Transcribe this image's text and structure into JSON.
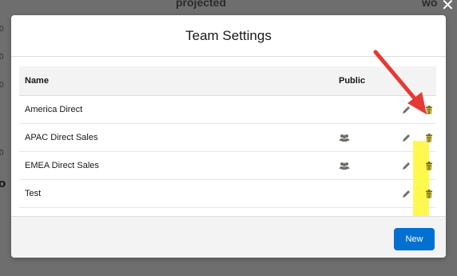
{
  "background": {
    "header_text_1": "projected",
    "header_text_2": "wo",
    "close_glyph": "✕",
    "left_numbers": [
      "0",
      "0",
      "0",
      "0"
    ],
    "left_big": "o"
  },
  "modal": {
    "title": "Team Settings",
    "columns": {
      "name": "Name",
      "public": "Public"
    },
    "rows": [
      {
        "name": "America Direct",
        "public_icon": false
      },
      {
        "name": "APAC Direct Sales",
        "public_icon": true
      },
      {
        "name": "EMEA Direct Sales",
        "public_icon": true
      },
      {
        "name": "Test",
        "public_icon": false
      }
    ],
    "new_label": "New"
  },
  "icons": {
    "edit": "pencil-icon",
    "delete": "trash-icon",
    "public": "group-icon"
  },
  "colors": {
    "overlay": "#6e6e6e",
    "accent_blue": "#0070d2",
    "highlight": "#fff94d",
    "arrow": "#e53935"
  }
}
